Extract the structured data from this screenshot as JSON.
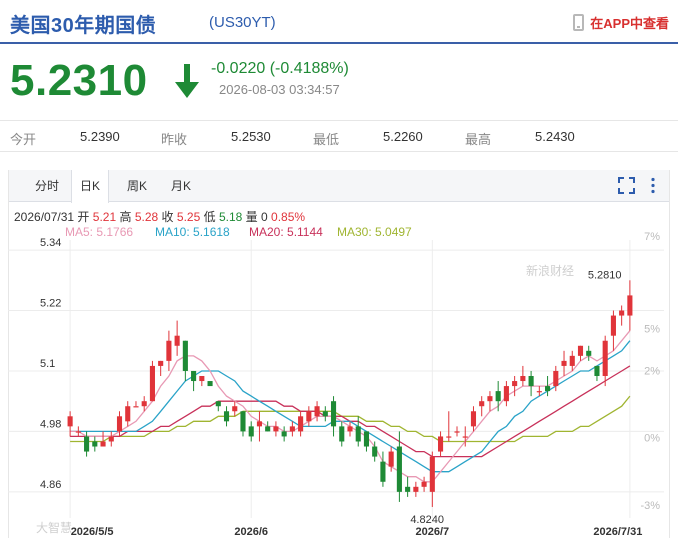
{
  "header": {
    "title": "美国30年期国债",
    "code": "(US30YT)",
    "app_link": "在APP中查看"
  },
  "quote": {
    "price": "5.2310",
    "change": "-0.0220 (-0.4188%)",
    "timestamp": "2026-08-03 03:34:57",
    "direction": "down"
  },
  "stats": [
    {
      "label": "今开",
      "value": "5.2390"
    },
    {
      "label": "昨收",
      "value": "5.2530"
    },
    {
      "label": "最低",
      "value": "5.2260"
    },
    {
      "label": "最高",
      "value": "5.2430"
    }
  ],
  "tabs": [
    {
      "label": "分时",
      "active": false
    },
    {
      "label": "日K",
      "active": true
    },
    {
      "label": "周K",
      "active": false
    },
    {
      "label": "月K",
      "active": false
    }
  ],
  "ohlc_line": {
    "date": "2026/07/31",
    "open_label": "开",
    "open": "5.21",
    "high_label": "高",
    "high": "5.28",
    "close_label": "收",
    "close": "5.25",
    "low_label": "低",
    "low": "5.18",
    "volume_label": "量",
    "volume": "0",
    "change_pct": "0.85%"
  },
  "ma_legend": [
    {
      "text": "MA5: 5.1766",
      "color": "#e899b4"
    },
    {
      "text": "MA10: 5.1618",
      "color": "#2aa3c8"
    },
    {
      "text": "MA20: 5.1144",
      "color": "#c8315a"
    },
    {
      "text": "MA30: 5.0497",
      "color": "#a0b531"
    }
  ],
  "watermarks": {
    "sina": "新浪财经",
    "bottom": "大智慧"
  },
  "colors": {
    "up": "#e0343a",
    "down": "#1e8a35",
    "brand": "#2d5cad",
    "app_red": "#d8302f"
  },
  "chart_data": {
    "type": "candlestick",
    "y_ticks": [
      "5.34",
      "5.22",
      "5.1",
      "4.98",
      "4.86"
    ],
    "y_pct_ticks": [
      "7%",
      "5%",
      "2%",
      "0%",
      "-3%"
    ],
    "x_labels": [
      "2026/5/5",
      "2026/6",
      "2026/7",
      "2026/7/31"
    ],
    "ylim": [
      4.82,
      5.36
    ],
    "max_label": "5.2810",
    "min_label": "4.8240",
    "candles": [
      [
        4.99,
        5.02,
        4.97,
        5.01
      ],
      [
        4.98,
        4.99,
        4.97,
        4.98
      ],
      [
        4.97,
        4.98,
        4.93,
        4.94
      ],
      [
        4.96,
        4.97,
        4.94,
        4.95
      ],
      [
        4.95,
        4.98,
        4.95,
        4.96
      ],
      [
        4.96,
        4.98,
        4.95,
        4.97
      ],
      [
        4.98,
        5.02,
        4.97,
        5.01
      ],
      [
        5.0,
        5.04,
        4.99,
        5.03
      ],
      [
        5.03,
        5.04,
        5.03,
        5.03
      ],
      [
        5.03,
        5.05,
        5.02,
        5.04
      ],
      [
        5.04,
        5.12,
        5.04,
        5.11
      ],
      [
        5.11,
        5.12,
        5.09,
        5.12
      ],
      [
        5.12,
        5.18,
        5.1,
        5.16
      ],
      [
        5.15,
        5.2,
        5.13,
        5.17
      ],
      [
        5.16,
        5.16,
        5.08,
        5.1
      ],
      [
        5.1,
        5.1,
        5.06,
        5.08
      ],
      [
        5.08,
        5.09,
        5.07,
        5.09
      ],
      [
        5.08,
        5.07,
        5.07,
        5.07
      ],
      [
        5.04,
        5.04,
        5.02,
        5.03
      ],
      [
        5.02,
        5.03,
        4.99,
        5.0
      ],
      [
        5.02,
        5.04,
        5.01,
        5.03
      ],
      [
        5.02,
        5.02,
        4.97,
        4.98
      ],
      [
        4.99,
        5.0,
        4.96,
        4.97
      ],
      [
        4.99,
        5.02,
        4.96,
        5.0
      ],
      [
        4.99,
        5.0,
        4.98,
        4.98
      ],
      [
        4.98,
        5.0,
        4.97,
        4.99
      ],
      [
        4.98,
        4.99,
        4.96,
        4.97
      ],
      [
        4.98,
        5.0,
        4.97,
        4.99
      ],
      [
        4.98,
        5.02,
        4.97,
        5.01
      ],
      [
        5.0,
        5.03,
        4.99,
        5.02
      ],
      [
        5.01,
        5.04,
        5.0,
        5.03
      ],
      [
        5.02,
        5.03,
        5.0,
        5.01
      ],
      [
        5.04,
        5.05,
        4.97,
        4.99
      ],
      [
        4.99,
        5.0,
        4.95,
        4.96
      ],
      [
        4.98,
        5.0,
        4.97,
        4.99
      ],
      [
        4.99,
        5.01,
        4.95,
        4.96
      ],
      [
        4.98,
        4.98,
        4.94,
        4.95
      ],
      [
        4.95,
        4.96,
        4.92,
        4.93
      ],
      [
        4.92,
        4.94,
        4.87,
        4.88
      ],
      [
        4.91,
        4.95,
        4.9,
        4.94
      ],
      [
        4.95,
        4.98,
        4.84,
        4.86
      ],
      [
        4.87,
        4.89,
        4.85,
        4.86
      ],
      [
        4.86,
        4.88,
        4.85,
        4.87
      ],
      [
        4.87,
        4.89,
        4.86,
        4.88
      ],
      [
        4.86,
        4.94,
        4.83,
        4.93
      ],
      [
        4.94,
        4.98,
        4.93,
        4.97
      ],
      [
        4.97,
        5.02,
        4.96,
        4.97
      ],
      [
        4.98,
        4.99,
        4.97,
        4.98
      ],
      [
        4.97,
        4.99,
        4.95,
        4.97
      ],
      [
        4.99,
        5.03,
        4.98,
        5.02
      ],
      [
        5.03,
        5.05,
        5.01,
        5.04
      ],
      [
        5.04,
        5.06,
        5.02,
        5.05
      ],
      [
        5.06,
        5.08,
        5.02,
        5.04
      ],
      [
        5.04,
        5.08,
        5.03,
        5.07
      ],
      [
        5.07,
        5.09,
        5.05,
        5.08
      ],
      [
        5.08,
        5.11,
        5.07,
        5.09
      ],
      [
        5.09,
        5.1,
        5.05,
        5.07
      ],
      [
        5.06,
        5.07,
        5.05,
        5.06
      ],
      [
        5.07,
        5.09,
        5.05,
        5.06
      ],
      [
        5.07,
        5.11,
        5.06,
        5.1
      ],
      [
        5.11,
        5.14,
        5.09,
        5.12
      ],
      [
        5.11,
        5.14,
        5.1,
        5.13
      ],
      [
        5.13,
        5.15,
        5.12,
        5.15
      ],
      [
        5.14,
        5.15,
        5.12,
        5.13
      ],
      [
        5.11,
        5.11,
        5.08,
        5.09
      ],
      [
        5.09,
        5.17,
        5.07,
        5.16
      ],
      [
        5.17,
        5.22,
        5.14,
        5.21
      ],
      [
        5.21,
        5.23,
        5.19,
        5.22
      ],
      [
        5.21,
        5.28,
        5.18,
        5.25
      ]
    ],
    "ma5": [
      4.98,
      4.98,
      4.97,
      4.97,
      4.97,
      4.97,
      4.98,
      4.99,
      5.0,
      5.02,
      5.04,
      5.07,
      5.09,
      5.12,
      5.13,
      5.13,
      5.12,
      5.1,
      5.07,
      5.05,
      5.04,
      5.03,
      5.01,
      5.0,
      4.99,
      4.99,
      4.98,
      4.98,
      4.99,
      5.0,
      5.01,
      5.01,
      5.01,
      5.0,
      4.99,
      4.98,
      4.97,
      4.95,
      4.92,
      4.91,
      4.9,
      4.89,
      4.89,
      4.88,
      4.88,
      4.9,
      4.92,
      4.94,
      4.96,
      4.98,
      5.0,
      5.02,
      5.03,
      5.05,
      5.06,
      5.07,
      5.07,
      5.07,
      5.07,
      5.08,
      5.09,
      5.1,
      5.12,
      5.13,
      5.12,
      5.13,
      5.14,
      5.16,
      5.18
    ],
    "ma10": [
      4.98,
      4.98,
      4.98,
      4.98,
      4.98,
      4.98,
      4.98,
      4.98,
      4.98,
      4.99,
      5.0,
      5.02,
      5.04,
      5.06,
      5.08,
      5.09,
      5.1,
      5.1,
      5.1,
      5.09,
      5.08,
      5.06,
      5.05,
      5.04,
      5.03,
      5.02,
      5.01,
      5.0,
      4.99,
      4.99,
      4.99,
      4.99,
      5.0,
      5.0,
      5.0,
      4.99,
      4.98,
      4.97,
      4.96,
      4.95,
      4.94,
      4.93,
      4.92,
      4.91,
      4.9,
      4.9,
      4.9,
      4.91,
      4.92,
      4.93,
      4.94,
      4.96,
      4.98,
      4.99,
      5.01,
      5.02,
      5.04,
      5.05,
      5.06,
      5.07,
      5.08,
      5.09,
      5.1,
      5.1,
      5.11,
      5.12,
      5.13,
      5.14,
      5.16
    ],
    "ma20": [
      4.97,
      4.97,
      4.97,
      4.97,
      4.97,
      4.97,
      4.97,
      4.98,
      4.98,
      4.98,
      4.98,
      4.99,
      4.99,
      5.0,
      5.01,
      5.02,
      5.03,
      5.03,
      5.04,
      5.04,
      5.04,
      5.04,
      5.04,
      5.04,
      5.04,
      5.04,
      5.03,
      5.03,
      5.02,
      5.02,
      5.02,
      5.01,
      5.01,
      5.01,
      5.0,
      5.0,
      4.99,
      4.99,
      4.98,
      4.97,
      4.96,
      4.95,
      4.94,
      4.94,
      4.93,
      4.93,
      4.93,
      4.93,
      4.93,
      4.93,
      4.93,
      4.94,
      4.95,
      4.96,
      4.97,
      4.98,
      4.99,
      5.0,
      5.01,
      5.02,
      5.03,
      5.04,
      5.05,
      5.06,
      5.07,
      5.08,
      5.09,
      5.1,
      5.11
    ],
    "ma30": [
      4.96,
      4.96,
      4.96,
      4.96,
      4.96,
      4.97,
      4.97,
      4.97,
      4.97,
      4.97,
      4.98,
      4.98,
      4.98,
      4.99,
      4.99,
      5.0,
      5.0,
      5.0,
      5.01,
      5.01,
      5.01,
      5.02,
      5.02,
      5.02,
      5.02,
      5.02,
      5.02,
      5.02,
      5.02,
      5.02,
      5.02,
      5.02,
      5.02,
      5.01,
      5.01,
      5.01,
      5.0,
      5.0,
      5.0,
      4.99,
      4.99,
      4.98,
      4.98,
      4.97,
      4.97,
      4.96,
      4.96,
      4.96,
      4.96,
      4.96,
      4.96,
      4.96,
      4.96,
      4.96,
      4.96,
      4.97,
      4.97,
      4.97,
      4.97,
      4.98,
      4.98,
      4.98,
      4.99,
      4.99,
      5.0,
      5.01,
      5.02,
      5.03,
      5.05
    ]
  }
}
